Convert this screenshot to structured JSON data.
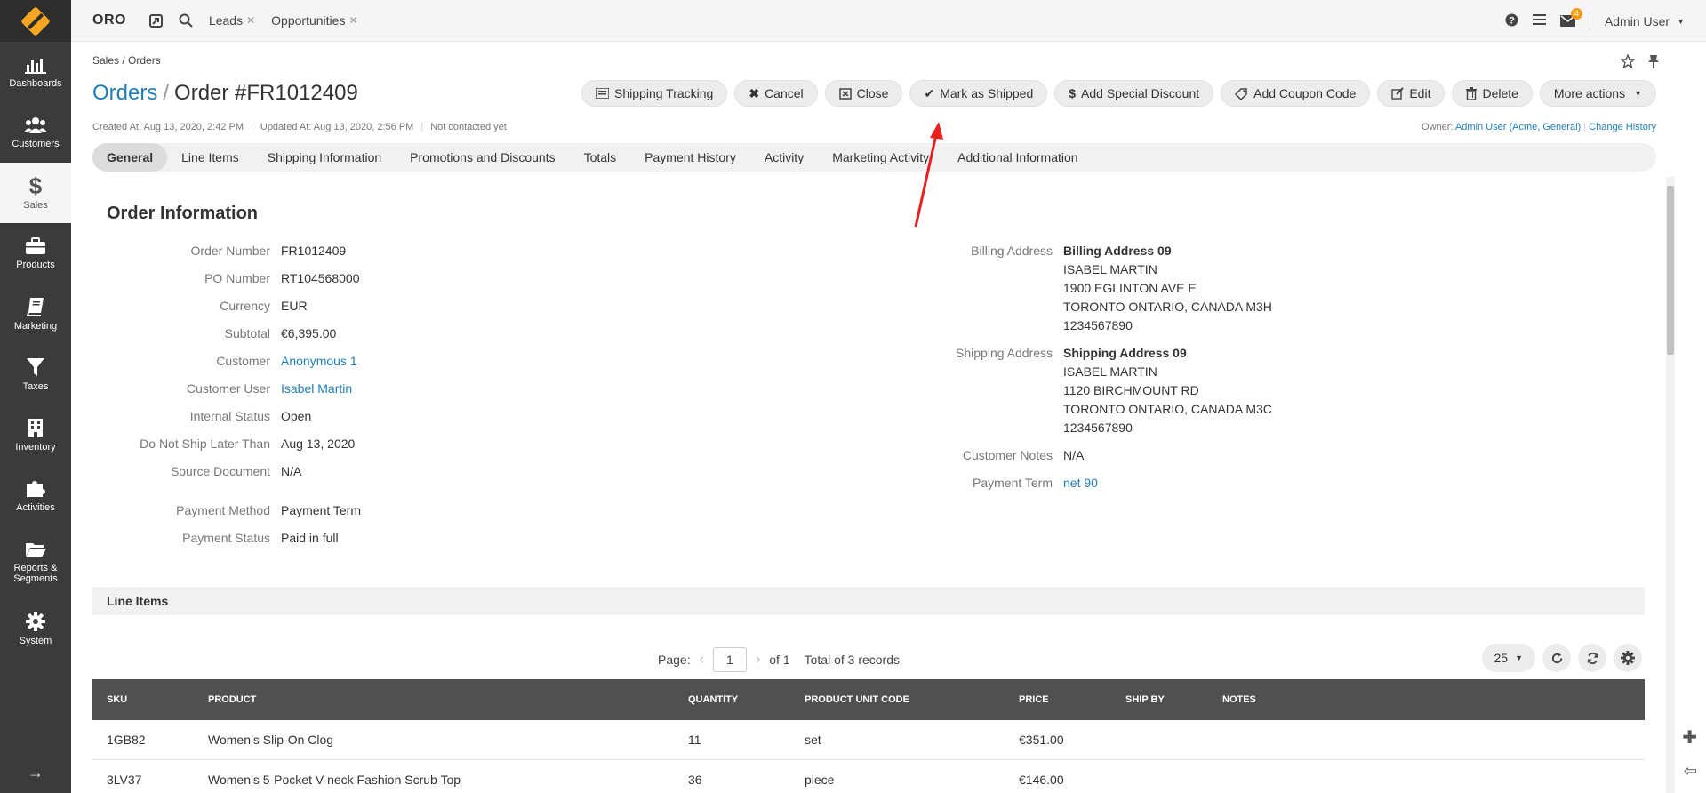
{
  "sidebar": {
    "items": [
      {
        "label": "Dashboards",
        "icon": "dashboards-icon"
      },
      {
        "label": "Customers",
        "icon": "customers-icon"
      },
      {
        "label": "Sales",
        "icon": "dollar-icon"
      },
      {
        "label": "Products",
        "icon": "briefcase-icon"
      },
      {
        "label": "Marketing",
        "icon": "book-icon"
      },
      {
        "label": "Taxes",
        "icon": "filter-icon"
      },
      {
        "label": "Inventory",
        "icon": "building-icon"
      },
      {
        "label": "Activities",
        "icon": "puzzle-icon"
      },
      {
        "label": "Reports &",
        "label2": "Segments",
        "icon": "folder-icon"
      },
      {
        "label": "System",
        "icon": "gear-icon"
      }
    ],
    "collapse": "→"
  },
  "topbar": {
    "brand": "ORO",
    "pinned": [
      {
        "label": "Leads",
        "close": "✕"
      },
      {
        "label": "Opportunities",
        "close": "✕"
      }
    ],
    "notification_count": "4",
    "user": "Admin User"
  },
  "page": {
    "breadcrumb": "Sales / Orders",
    "title_crumb": "Orders",
    "title_sep": "/",
    "title": "Order #FR1012409",
    "actions": [
      {
        "label": "Shipping Tracking",
        "icon": "list-icon"
      },
      {
        "label": "Cancel",
        "icon": "x-icon"
      },
      {
        "label": "Close",
        "icon": "close-box-icon"
      },
      {
        "label": "Mark as Shipped",
        "icon": "check-icon"
      },
      {
        "label": "Add Special Discount",
        "icon": "dollar-icon"
      },
      {
        "label": "Add Coupon Code",
        "icon": "tag-icon"
      },
      {
        "label": "Edit",
        "icon": "edit-icon"
      },
      {
        "label": "Delete",
        "icon": "trash-icon"
      },
      {
        "label": "More actions",
        "icon": "caret-down-icon"
      }
    ],
    "meta": {
      "created": "Created At: Aug 13, 2020, 2:42 PM",
      "updated": "Updated At: Aug 13, 2020, 2:56 PM",
      "contacted": "Not contacted yet"
    },
    "owner_label": "Owner:",
    "owner_value": "Admin User (Acme, General)",
    "change_history": "Change History",
    "tabs": [
      "General",
      "Line Items",
      "Shipping Information",
      "Promotions and Discounts",
      "Totals",
      "Payment History",
      "Activity",
      "Marketing Activity",
      "Additional Information"
    ]
  },
  "order_info": {
    "title": "Order Information",
    "left": [
      {
        "label": "Order Number",
        "value": "FR1012409"
      },
      {
        "label": "PO Number",
        "value": "RT104568000"
      },
      {
        "label": "Currency",
        "value": "EUR"
      },
      {
        "label": "Subtotal",
        "value": "€6,395.00"
      },
      {
        "label": "Customer",
        "value": "Anonymous 1"
      },
      {
        "label": "Customer User",
        "value": "Isabel Martin"
      },
      {
        "label": "Internal Status",
        "value": "Open"
      },
      {
        "label": "Do Not Ship Later Than",
        "value": "Aug 13, 2020"
      },
      {
        "label": "Source Document",
        "value": "N/A"
      },
      {
        "label": "Payment Method",
        "value": "Payment Term"
      },
      {
        "label": "Payment Status",
        "value": "Paid in full"
      }
    ],
    "billing": {
      "label": "Billing Address",
      "lines": [
        "Billing Address 09",
        "ISABEL MARTIN",
        "1900 EGLINTON AVE E",
        "TORONTO ONTARIO, CANADA M3H",
        "1234567890"
      ]
    },
    "shipping": {
      "label": "Shipping Address",
      "lines": [
        "Shipping Address 09",
        "ISABEL MARTIN",
        "1120 BIRCHMOUNT RD",
        "TORONTO ONTARIO, CANADA M3C",
        "1234567890"
      ]
    },
    "customer_notes": {
      "label": "Customer Notes",
      "value": "N/A"
    },
    "payment_term": {
      "label": "Payment Term",
      "value": "net 90"
    }
  },
  "line_items": {
    "title": "Line Items",
    "pager": {
      "page_label": "Page:",
      "page": "1",
      "of": "of 1",
      "total": "Total of 3 records"
    },
    "per_page": "25",
    "columns": [
      "SKU",
      "PRODUCT",
      "QUANTITY",
      "PRODUCT UNIT CODE",
      "PRICE",
      "SHIP BY",
      "NOTES"
    ],
    "rows": [
      [
        "1GB82",
        "Women’s Slip-On Clog",
        "11",
        "set",
        "€351.00",
        "",
        ""
      ],
      [
        "3LV37",
        "Women’s 5-Pocket V-neck Fashion Scrub Top",
        "36",
        "piece",
        "€146.00",
        "",
        ""
      ]
    ]
  },
  "colors": {
    "accent": "#1f7fb4",
    "sidebar": "#3b3b3b",
    "grid_header": "#505050",
    "annotation": "#e8201e"
  }
}
